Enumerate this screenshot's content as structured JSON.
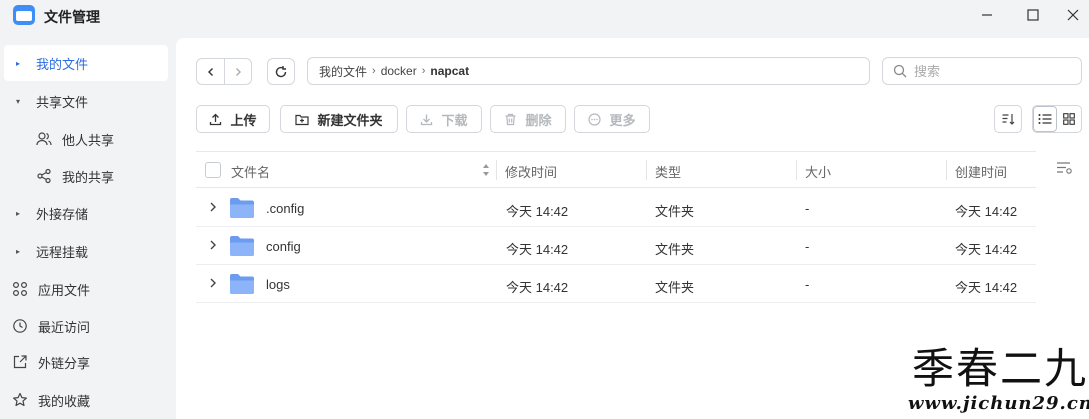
{
  "app": {
    "title": "文件管理"
  },
  "sidebar": {
    "items": [
      {
        "label": "我的文件"
      },
      {
        "label": "共享文件"
      },
      {
        "label": "他人共享"
      },
      {
        "label": "我的共享"
      },
      {
        "label": "外接存储"
      },
      {
        "label": "远程挂载"
      },
      {
        "label": "应用文件"
      },
      {
        "label": "最近访问"
      },
      {
        "label": "外链分享"
      },
      {
        "label": "我的收藏"
      }
    ]
  },
  "path": {
    "segments": [
      "我的文件",
      "docker",
      "napcat"
    ]
  },
  "search": {
    "placeholder": "搜索"
  },
  "toolbar": {
    "upload": "上传",
    "new_folder": "新建文件夹",
    "download": "下载",
    "delete": "删除",
    "more": "更多"
  },
  "table": {
    "columns": [
      "文件名",
      "修改时间",
      "类型",
      "大小",
      "创建时间"
    ],
    "rows": [
      {
        "name": ".config",
        "modified": "今天 14:42",
        "type": "文件夹",
        "size": "-",
        "created": "今天 14:42"
      },
      {
        "name": "config",
        "modified": "今天 14:42",
        "type": "文件夹",
        "size": "-",
        "created": "今天 14:42"
      },
      {
        "name": "logs",
        "modified": "今天 14:42",
        "type": "文件夹",
        "size": "-",
        "created": "今天 14:42"
      }
    ]
  },
  "watermark": {
    "title": "季春二九",
    "url": "www.jichun29.cn"
  },
  "colors": {
    "accent": "#2b6de0",
    "folder": "#7ba7f7"
  }
}
